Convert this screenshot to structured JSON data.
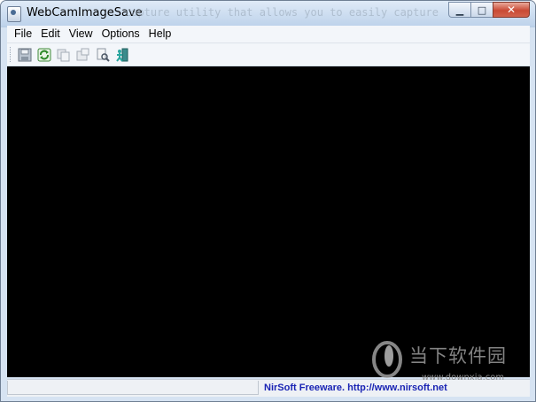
{
  "window": {
    "title": "WebCamImageSave",
    "title_overlay_text": "capture utility that allows you to easily capture",
    "buttons": {
      "minimize": "▁",
      "maximize": "□",
      "close": "✕"
    }
  },
  "menu": {
    "items": [
      {
        "label": "File"
      },
      {
        "label": "Edit"
      },
      {
        "label": "View"
      },
      {
        "label": "Options"
      },
      {
        "label": "Help"
      }
    ]
  },
  "toolbar": {
    "buttons": [
      {
        "icon": "save-icon"
      },
      {
        "icon": "refresh-icon"
      },
      {
        "icon": "copy-icon"
      },
      {
        "icon": "properties-icon"
      },
      {
        "icon": "find-icon"
      },
      {
        "icon": "exit-icon"
      }
    ]
  },
  "status": {
    "left_panel": "",
    "link_text": "NirSoft Freeware.  http://www.nirsoft.net"
  },
  "watermark": {
    "brand": "当下软件园",
    "url": "www.downxia.com"
  },
  "colors": {
    "viewport_bg": "#000000",
    "status_link": "#1a24b4",
    "titlebar": "#c9dbef"
  }
}
